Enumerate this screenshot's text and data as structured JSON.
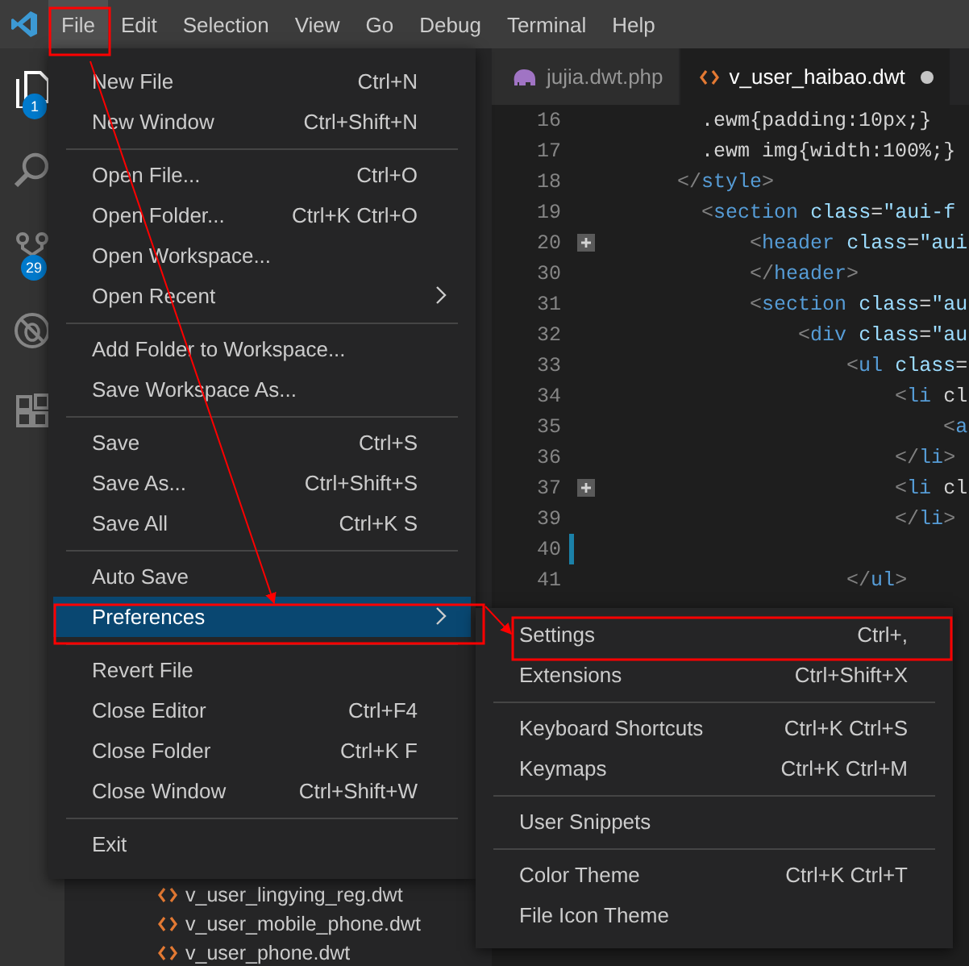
{
  "menubar": {
    "items": [
      {
        "label": "File",
        "selected": true
      },
      {
        "label": "Edit",
        "selected": false
      },
      {
        "label": "Selection",
        "selected": false
      },
      {
        "label": "View",
        "selected": false
      },
      {
        "label": "Go",
        "selected": false
      },
      {
        "label": "Debug",
        "selected": false
      },
      {
        "label": "Terminal",
        "selected": false
      },
      {
        "label": "Help",
        "selected": false
      }
    ]
  },
  "activity_bar": {
    "items": [
      {
        "kind": "files",
        "badge": "1"
      },
      {
        "kind": "search"
      },
      {
        "kind": "source-control",
        "badge": "29"
      },
      {
        "kind": "debug"
      },
      {
        "kind": "extensions"
      }
    ]
  },
  "explorer": {
    "files": [
      "v_user_lingying_reg.dwt",
      "v_user_mobile_phone.dwt",
      "v_user_phone.dwt"
    ]
  },
  "tabs": [
    {
      "label": "jujia.dwt.php",
      "kind": "php",
      "selected": false,
      "dirty": false
    },
    {
      "label": "v_user_haibao.dwt",
      "kind": "dwt",
      "selected": true,
      "dirty": true
    }
  ],
  "editor": {
    "lines": [
      {
        "number": "16",
        "text": "      .ewm{padding:10px;}",
        "folded": false,
        "modified": false
      },
      {
        "number": "17",
        "text": "      .ewm img{width:100%;}",
        "folded": false,
        "modified": false
      },
      {
        "number": "18",
        "text": "    </style>",
        "folded": false,
        "modified": false
      },
      {
        "number": "19",
        "text": "      <section class=\"aui-f",
        "folded": false,
        "modified": false
      },
      {
        "number": "20",
        "text": "          <header class=\"aui",
        "folded": true,
        "modified": false
      },
      {
        "number": "30",
        "text": "          </header>",
        "folded": false,
        "modified": false
      },
      {
        "number": "31",
        "text": "          <section class=\"au",
        "folded": false,
        "modified": false
      },
      {
        "number": "32",
        "text": "              <div class=\"au",
        "folded": false,
        "modified": false
      },
      {
        "number": "33",
        "text": "                  <ul class=",
        "folded": false,
        "modified": false
      },
      {
        "number": "34",
        "text": "                      <li cl",
        "folded": false,
        "modified": false
      },
      {
        "number": "35",
        "text": "                          <a",
        "folded": false,
        "modified": false
      },
      {
        "number": "36",
        "text": "                      </li>",
        "folded": false,
        "modified": false
      },
      {
        "number": "37",
        "text": "                      <li cl",
        "folded": true,
        "modified": false
      },
      {
        "number": "39",
        "text": "                      </li>",
        "folded": false,
        "modified": false
      },
      {
        "number": "40",
        "folded": false,
        "modified": true
      },
      {
        "number": "41",
        "text": "                  </ul>",
        "folded": false,
        "modified": false
      }
    ]
  },
  "file_menu": {
    "groups": [
      [
        {
          "label": "New File",
          "shortcut": "Ctrl+N",
          "submenu": false,
          "selected": false
        },
        {
          "label": "New Window",
          "shortcut": "Ctrl+Shift+N",
          "submenu": false,
          "selected": false
        }
      ],
      [
        {
          "label": "Open File...",
          "shortcut": "Ctrl+O",
          "submenu": false,
          "selected": false
        },
        {
          "label": "Open Folder...",
          "shortcut": "Ctrl+K Ctrl+O",
          "submenu": false,
          "selected": false
        },
        {
          "label": "Open Workspace...",
          "submenu": false,
          "selected": false
        },
        {
          "label": "Open Recent",
          "submenu": true,
          "selected": false
        }
      ],
      [
        {
          "label": "Add Folder to Workspace...",
          "submenu": false,
          "selected": false
        },
        {
          "label": "Save Workspace As...",
          "submenu": false,
          "selected": false
        }
      ],
      [
        {
          "label": "Save",
          "shortcut": "Ctrl+S",
          "submenu": false,
          "selected": false
        },
        {
          "label": "Save As...",
          "shortcut": "Ctrl+Shift+S",
          "submenu": false,
          "selected": false
        },
        {
          "label": "Save All",
          "shortcut": "Ctrl+K S",
          "submenu": false,
          "selected": false
        }
      ],
      [
        {
          "label": "Auto Save",
          "submenu": false,
          "selected": false
        },
        {
          "label": "Preferences",
          "submenu": true,
          "selected": true
        }
      ],
      [
        {
          "label": "Revert File",
          "submenu": false,
          "selected": false
        },
        {
          "label": "Close Editor",
          "shortcut": "Ctrl+F4",
          "submenu": false,
          "selected": false
        },
        {
          "label": "Close Folder",
          "shortcut": "Ctrl+K F",
          "submenu": false,
          "selected": false
        },
        {
          "label": "Close Window",
          "shortcut": "Ctrl+Shift+W",
          "submenu": false,
          "selected": false
        }
      ],
      [
        {
          "label": "Exit",
          "submenu": false,
          "selected": false
        }
      ]
    ]
  },
  "preferences_menu": {
    "groups": [
      [
        {
          "label": "Settings",
          "shortcut": "Ctrl+,"
        },
        {
          "label": "Extensions",
          "shortcut": "Ctrl+Shift+X"
        }
      ],
      [
        {
          "label": "Keyboard Shortcuts",
          "shortcut": "Ctrl+K Ctrl+S"
        },
        {
          "label": "Keymaps",
          "shortcut": "Ctrl+K Ctrl+M"
        }
      ],
      [
        {
          "label": "User Snippets"
        }
      ],
      [
        {
          "label": "Color Theme",
          "shortcut": "Ctrl+K Ctrl+T"
        },
        {
          "label": "File Icon Theme"
        }
      ]
    ]
  }
}
